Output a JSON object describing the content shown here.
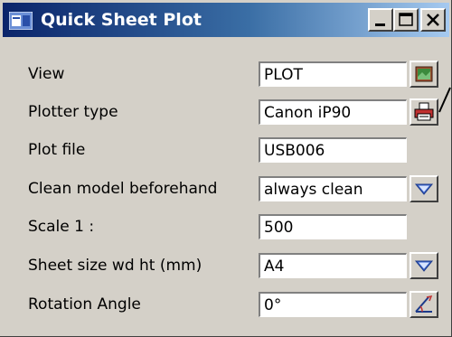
{
  "window": {
    "title": "Quick Sheet Plot",
    "icon": "plot-window-icon",
    "controls": [
      "minimize-icon",
      "maximize-icon",
      "close-icon"
    ]
  },
  "fields": [
    {
      "label": "View",
      "value": "PLOT",
      "button_icon": "image-icon"
    },
    {
      "label": "Plotter type",
      "value": "Canon iP90",
      "button_icon": "printer-icon"
    },
    {
      "label": "Plot file",
      "value": "USB006"
    },
    {
      "label": "Clean model beforehand",
      "value": "always clean",
      "button_icon": "dropdown-arrow-icon"
    },
    {
      "label": "Scale 1 :",
      "value": "500"
    },
    {
      "label": "Sheet size wd ht (mm)",
      "value": "A4",
      "button_icon": "dropdown-arrow-icon"
    },
    {
      "label": "Rotation Angle",
      "value": "0°",
      "button_icon": "angle-pick-icon"
    }
  ],
  "colors": {
    "titlebar_start": "#0a246a",
    "titlebar_end": "#a6caf0",
    "dialog_bg": "#d4d0c8",
    "dropdown_arrow": "#3a63c8"
  }
}
